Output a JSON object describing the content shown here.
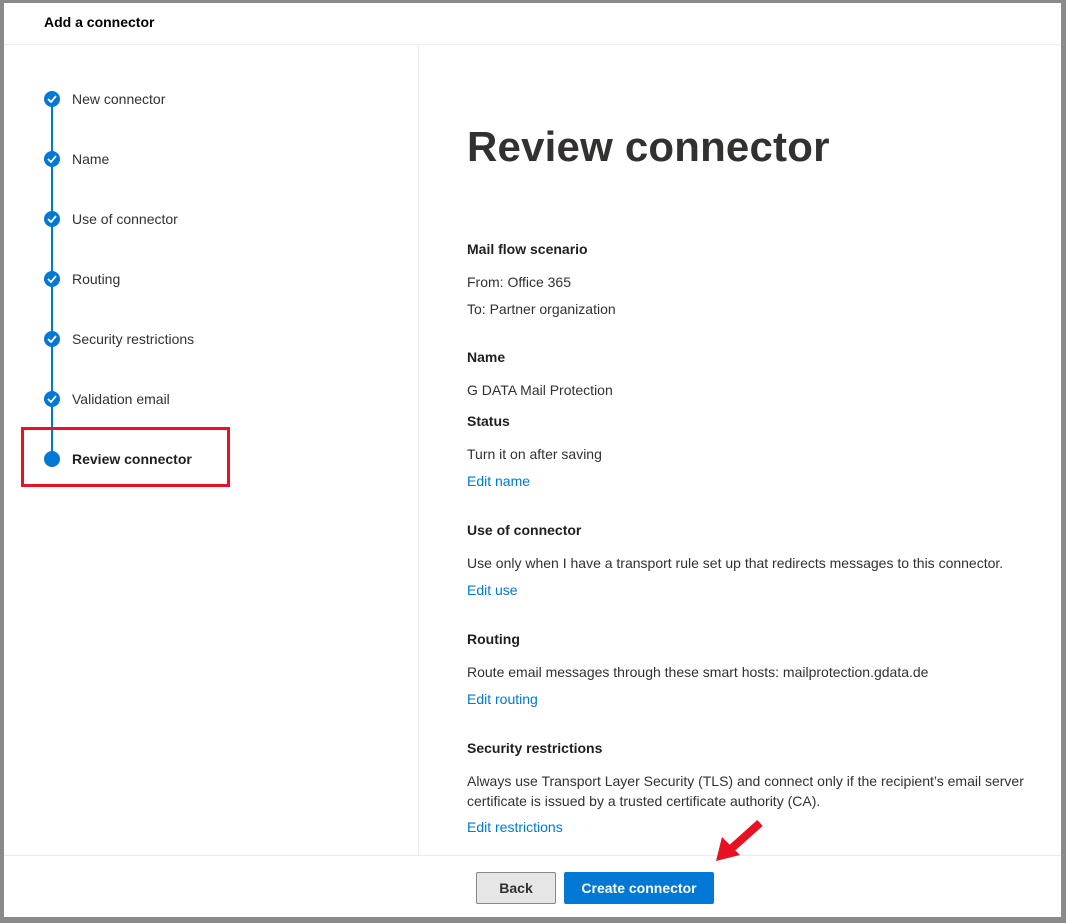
{
  "header": {
    "title": "Add a connector"
  },
  "steps": [
    {
      "label": "New connector",
      "state": "done"
    },
    {
      "label": "Name",
      "state": "done"
    },
    {
      "label": "Use of connector",
      "state": "done"
    },
    {
      "label": "Routing",
      "state": "done"
    },
    {
      "label": "Security restrictions",
      "state": "done"
    },
    {
      "label": "Validation email",
      "state": "done"
    },
    {
      "label": "Review connector",
      "state": "current"
    }
  ],
  "main": {
    "title": "Review connector",
    "sections": {
      "mail_flow": {
        "heading": "Mail flow scenario",
        "from": "From: Office 365",
        "to": "To: Partner organization"
      },
      "name": {
        "heading": "Name",
        "value": "G DATA Mail Protection"
      },
      "status": {
        "heading": "Status",
        "value": "Turn it on after saving",
        "edit_link": "Edit name"
      },
      "use": {
        "heading": "Use of connector",
        "value": "Use only when I have a transport rule set up that redirects messages to this connector.",
        "edit_link": "Edit use"
      },
      "routing": {
        "heading": "Routing",
        "value": "Route email messages through these smart hosts: mailprotection.gdata.de",
        "edit_link": "Edit routing"
      },
      "security": {
        "heading": "Security restrictions",
        "value_line1": "Always use Transport Layer Security (TLS) and connect only if the recipient’s email server",
        "value_line2": "certificate is issued by a trusted certificate authority (CA).",
        "edit_link": "Edit restrictions"
      }
    }
  },
  "footer": {
    "back_label": "Back",
    "create_label": "Create connector"
  },
  "colors": {
    "accent": "#0078d4",
    "highlight": "#e81123"
  }
}
